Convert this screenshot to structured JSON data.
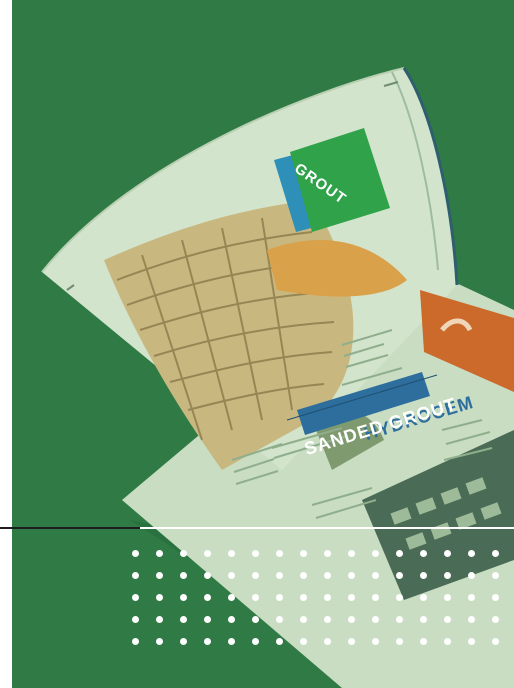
{
  "image": {
    "subject": "open printed brochure lying on a green surface",
    "colors": {
      "background": "#2f7a45",
      "paper": "#cfe0c6",
      "tab_green": "#2fa24a",
      "tab_blue": "#2e8fb8",
      "accent_blue": "#2d6e9c",
      "dots": "#ffffff"
    }
  },
  "brochure": {
    "tab_label": "GROUT",
    "heading_line_1": "HYDROCEM",
    "heading_line_2": "SANDED GROUT"
  }
}
